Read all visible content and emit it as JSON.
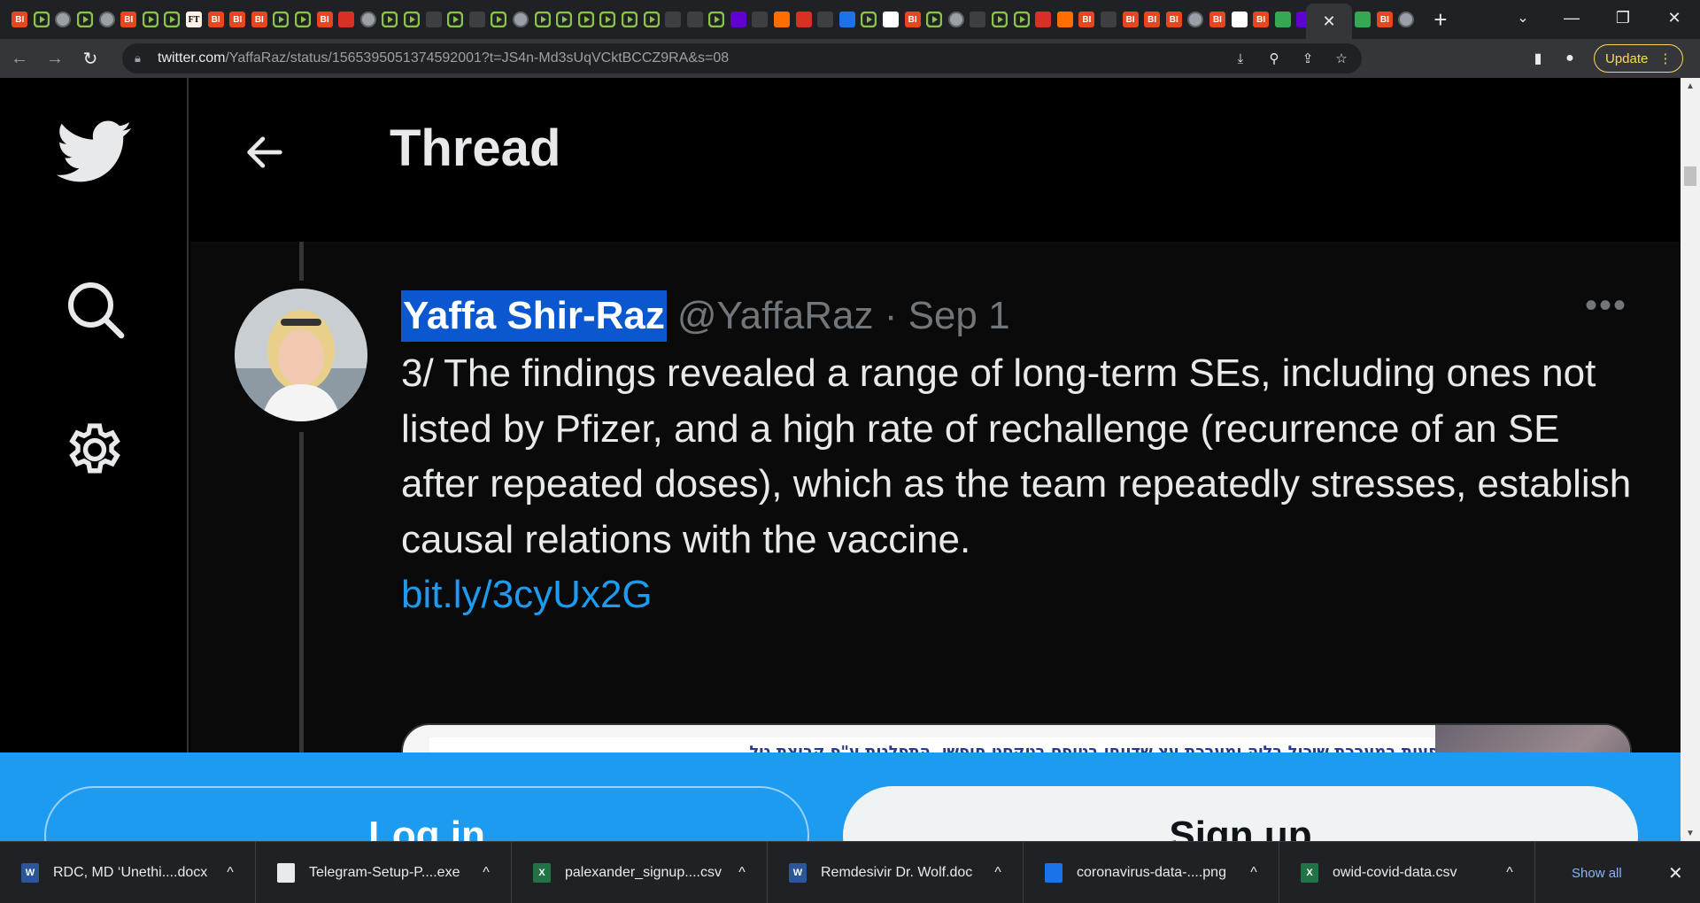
{
  "browser": {
    "tab_favicons": [
      "bi",
      "play",
      "globe",
      "play",
      "globe",
      "bi",
      "play",
      "play",
      "ft",
      "bi",
      "bi",
      "bi",
      "play",
      "play",
      "bi",
      "red",
      "globe",
      "play",
      "play",
      "doc",
      "play",
      "doc",
      "play",
      "globe",
      "play",
      "play",
      "play",
      "play",
      "play",
      "play",
      "doc",
      "doc",
      "play",
      "purple",
      "doc",
      "orange",
      "red",
      "doc",
      "blue",
      "play",
      "white",
      "bi",
      "play",
      "globe",
      "doc",
      "play",
      "play",
      "red",
      "orange",
      "bi",
      "doc",
      "bi",
      "bi",
      "bi",
      "globe",
      "bi",
      "white",
      "bi",
      "green",
      "purple",
      "doc"
    ],
    "tab_favicon_labels": {
      "bi": "BI",
      "ft": "FT"
    },
    "after_active_favicons": [
      "green",
      "bi",
      "globe"
    ],
    "new_tab_label": "+",
    "address": {
      "host": "twitter.com",
      "path": "/YaffaRaz/status/1565395051374592001?t=JS4n-Md3sUqVCktBCCZ9RA&s=08"
    },
    "update_label": "Update"
  },
  "twitter": {
    "header_title": "Thread",
    "tweet": {
      "author_name": "Yaffa Shir-Raz",
      "handle_and_date": "@YaffaRaz · Sep 1",
      "more_label": "•••",
      "text": "3/ The findings revealed a range of long-term SEs, including ones not listed by Pfizer, and a high rate of rechallenge (recurrence of an SE after repeated doses), which as the team repeatedly stresses, establish causal relations with the vaccine.",
      "link": "bit.ly/3cyUx2G",
      "media_caption": "פעות במערכת שיכול בליה ומערכת עצ שדווחו בטופס בטקסט חופשי, התפלגות ע\"פ קבוצת גיל"
    },
    "login_label": "Log in",
    "signup_label": "Sign up"
  },
  "downloads": {
    "items": [
      {
        "name": "RDC, MD ‘Unethi....docx",
        "type": "word"
      },
      {
        "name": "Telegram-Setup-P....exe",
        "type": "exe"
      },
      {
        "name": "palexander_signup....csv",
        "type": "excel"
      },
      {
        "name": "Remdesivir Dr. Wolf.doc",
        "type": "word"
      },
      {
        "name": "coronavirus-data-....png",
        "type": "image"
      },
      {
        "name": "owid-covid-data.csv",
        "type": "excel"
      }
    ],
    "file_icon_labels": {
      "word": "W",
      "excel": "X"
    },
    "show_all_label": "Show all"
  },
  "colors": {
    "twitter_blue": "#1d9bf0",
    "selection": "#0b57d0"
  }
}
